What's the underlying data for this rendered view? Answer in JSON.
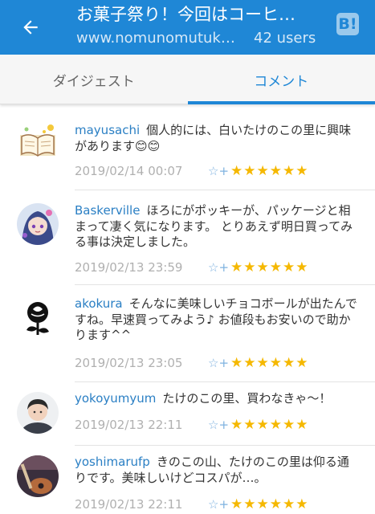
{
  "header": {
    "title": "お菓子祭り！今回はコーヒ…",
    "url": "www.nomunomutuk…",
    "users": "42 users",
    "brand": "B!",
    "icons": {
      "back": "back-arrow-icon",
      "brand": "hatena-bookmark-logo"
    },
    "colors": {
      "bar": "#1f87d6",
      "accent_text": "#2a7fc4",
      "star": "#f5b800"
    }
  },
  "tabs": [
    {
      "label": "ダイジェスト",
      "active": false
    },
    {
      "label": "コメント",
      "active": true
    }
  ],
  "comments": [
    {
      "user": "mayusachi",
      "text": "個人的には、白いたけのこの里に興味があります😊😊",
      "date": "2019/02/14 00:07",
      "add_star_icon": "☆+",
      "stars": "★★★★★★"
    },
    {
      "user": "Baskerville",
      "text": "ほろにがポッキーが、パッケージと相まって凄く気になります。 とりあえず明日買ってみる事は決定しました。",
      "date": "2019/02/13 23:59",
      "add_star_icon": "☆+",
      "stars": "★★★★★★"
    },
    {
      "user": "akokura",
      "text": "そんなに美味しいチョコボールが出たんですね。早速買ってみよう♪ お値段もお安いので助かります^^",
      "date": "2019/02/13 23:05",
      "add_star_icon": "☆+",
      "stars": "★★★★★★"
    },
    {
      "user": "yokoyumyum",
      "text": "たけのこの里、買わなきゃ〜！",
      "date": "2019/02/13 22:11",
      "add_star_icon": "☆+",
      "stars": "★★★★★★"
    },
    {
      "user": "yoshimarufp",
      "text": "きのこの山、たけのこの里は仰る通りです。美味しいけどコスパが…。",
      "date": "2019/02/13 22:11",
      "add_star_icon": "☆+",
      "stars": "★★★★★★"
    }
  ]
}
